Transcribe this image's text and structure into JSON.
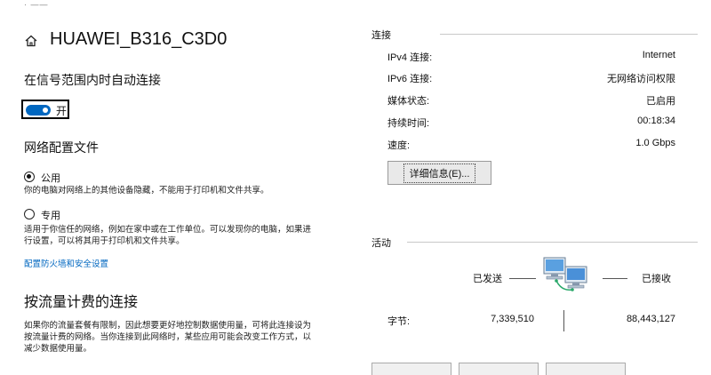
{
  "settings": {
    "top_fragment": "· ——",
    "network_name": "HUAWEI_B316_C3D0",
    "auto_connect_label": "在信号范围内时自动连接",
    "toggle_state": "开",
    "profile_title": "网络配置文件",
    "public_label": "公用",
    "public_desc": "你的电脑对网络上的其他设备隐藏，不能用于打印机和文件共享。",
    "private_label": "专用",
    "private_desc": "适用于你信任的网络，例如在家中或在工作单位。可以发现你的电脑，如果进行设置，可以将其用于打印机和文件共享。",
    "firewall_link": "配置防火墙和安全设置",
    "metered_title": "按流量计费的连接",
    "metered_desc": "如果你的流量套餐有限制，因此想要更好地控制数据使用量，可将此连接设为按流量计费的网络。当你连接到此网络时，某些应用可能会改变工作方式，以减少数据使用量。"
  },
  "status": {
    "connection_heading": "连接",
    "rows": [
      {
        "label": "IPv4 连接:",
        "value": "Internet"
      },
      {
        "label": "IPv6 连接:",
        "value": "无网络访问权限"
      },
      {
        "label": "媒体状态:",
        "value": "已启用"
      },
      {
        "label": "持续时间:",
        "value": "00:18:34"
      },
      {
        "label": "速度:",
        "value": "1.0 Gbps"
      }
    ],
    "details_button": "详细信息(E)...",
    "activity_heading": "活动",
    "sent_label": "已发送",
    "received_label": "已接收",
    "bytes_label": "字节:",
    "bytes_sent": "7,339,510",
    "bytes_received": "88,443,127"
  },
  "colors": {
    "accent": "#0067c0",
    "link": "#0067c0"
  }
}
